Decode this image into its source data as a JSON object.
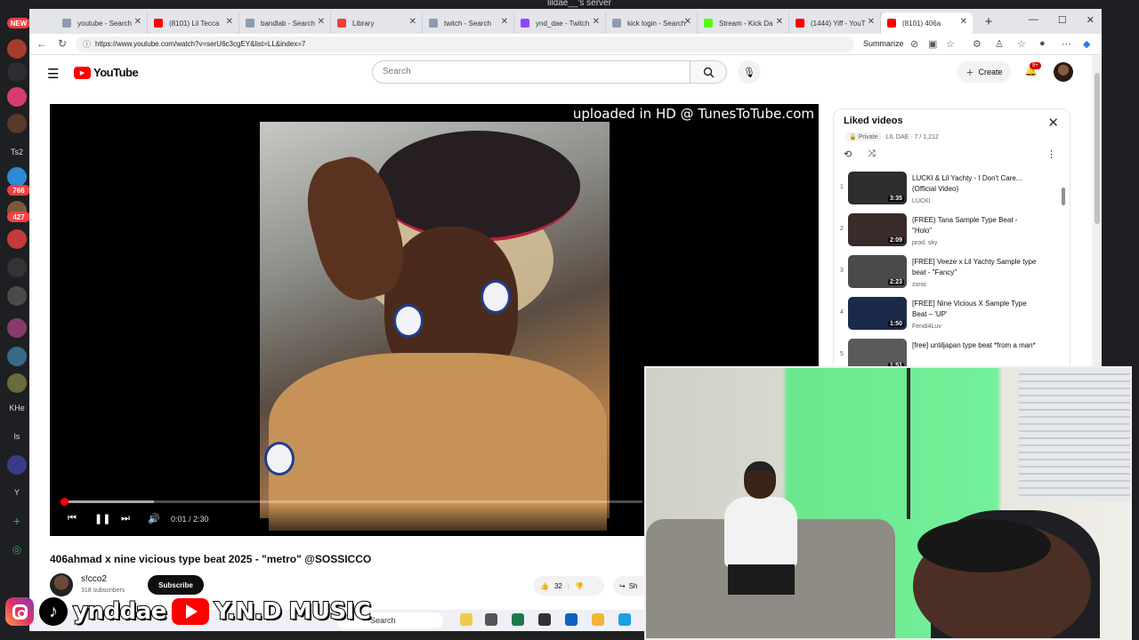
{
  "discord": {
    "server_name": "lildae__'s server",
    "rail": [
      {
        "label": "NEW",
        "type": "badge"
      },
      {
        "label": "Ts2",
        "type": "text"
      },
      {
        "label": "766",
        "type": "badge"
      },
      {
        "label": "427",
        "type": "badge"
      },
      {
        "label": "KHe",
        "type": "text"
      },
      {
        "label": "ls",
        "type": "text"
      },
      {
        "label": "Y",
        "type": "text"
      }
    ]
  },
  "browser": {
    "tabs": [
      {
        "title": "youtube - Search",
        "icon": "search-icon",
        "color": "#8e9bb0"
      },
      {
        "title": "(8101) Lil Tecca",
        "icon": "youtube-icon",
        "color": "#ff0000"
      },
      {
        "title": "bandlab - Search",
        "icon": "search-icon",
        "color": "#8e9bb0"
      },
      {
        "title": "Library",
        "icon": "bandlab-icon",
        "color": "#f03c3c"
      },
      {
        "title": "twitch - Search",
        "icon": "search-icon",
        "color": "#8e9bb0"
      },
      {
        "title": "ynd_dae - Twitch",
        "icon": "twitch-icon",
        "color": "#9146ff"
      },
      {
        "title": "kick login - Search",
        "icon": "search-icon",
        "color": "#8e9bb0"
      },
      {
        "title": "Stream - Kick Da",
        "icon": "kick-icon",
        "color": "#53fc18"
      },
      {
        "title": "(1444) Yiff - YouT",
        "icon": "youtube-icon",
        "color": "#ff0000"
      },
      {
        "title": "(8101) 406a",
        "icon": "youtube-icon",
        "color": "#ff0000"
      }
    ],
    "new_tab_label": "+",
    "url": "https://www.youtube.com/watch?v=serU6c3cgEY&list=LL&index=7",
    "summarize_label": "Summarize"
  },
  "youtube": {
    "logo_text": "YouTube",
    "search_placeholder": "Search",
    "create_label": "Create",
    "notification_count": "9+",
    "player": {
      "watermark": "uploaded in HD @ TunesToTube.com",
      "current_time": "0:01",
      "duration": "2:30",
      "progress": 0.0067,
      "buffered": 0.16
    },
    "video": {
      "title": "406ahmad x nine vicious type beat 2025 - \"metro\" @SOSSICCO",
      "channel": "s!cco2",
      "subscribers": "318 subscribers",
      "subscribe_label": "Subscribe",
      "likes": "32",
      "share_label": "Sh"
    },
    "playlist": {
      "title": "Liked videos",
      "privacy": "Private",
      "owner_pos": "LIL DAE · 7 / 1,212",
      "items": [
        {
          "index": "1",
          "title": "LUCKI & Lil Yachty - I Don't Care... (Official Video)",
          "author": "LUCKI",
          "duration": "3:35",
          "thumb": "#2d2d2d"
        },
        {
          "index": "2",
          "title": "(FREE) Tana Sample Type Beat - \"Holo\"",
          "author": "prod. sky",
          "duration": "2:09",
          "thumb": "#3b2b2b"
        },
        {
          "index": "3",
          "title": "[FREE] Veeze x Lil Yachty Sample type beat - \"Fancy\"",
          "author": "zonic",
          "duration": "2:23",
          "thumb": "#4a4a4a"
        },
        {
          "index": "4",
          "title": "[FREE] Nine Vicious X Sample Type Beat – 'UP'",
          "author": "Fendi4Luv",
          "duration": "1:50",
          "thumb": "#1c2a4a"
        },
        {
          "index": "5",
          "title": "[free] untiljapan type beat *from a man*",
          "author": "",
          "duration": "1:51",
          "thumb": "#5a5a5a"
        }
      ]
    }
  },
  "taskbar": {
    "search_label": "Search"
  },
  "overlay": {
    "tiktok_handle": "ynddae",
    "youtube_channel": "Y.N.D MUSIC"
  },
  "colors": {
    "youtube_red": "#ff0000",
    "green_screen": "#73f09a"
  }
}
